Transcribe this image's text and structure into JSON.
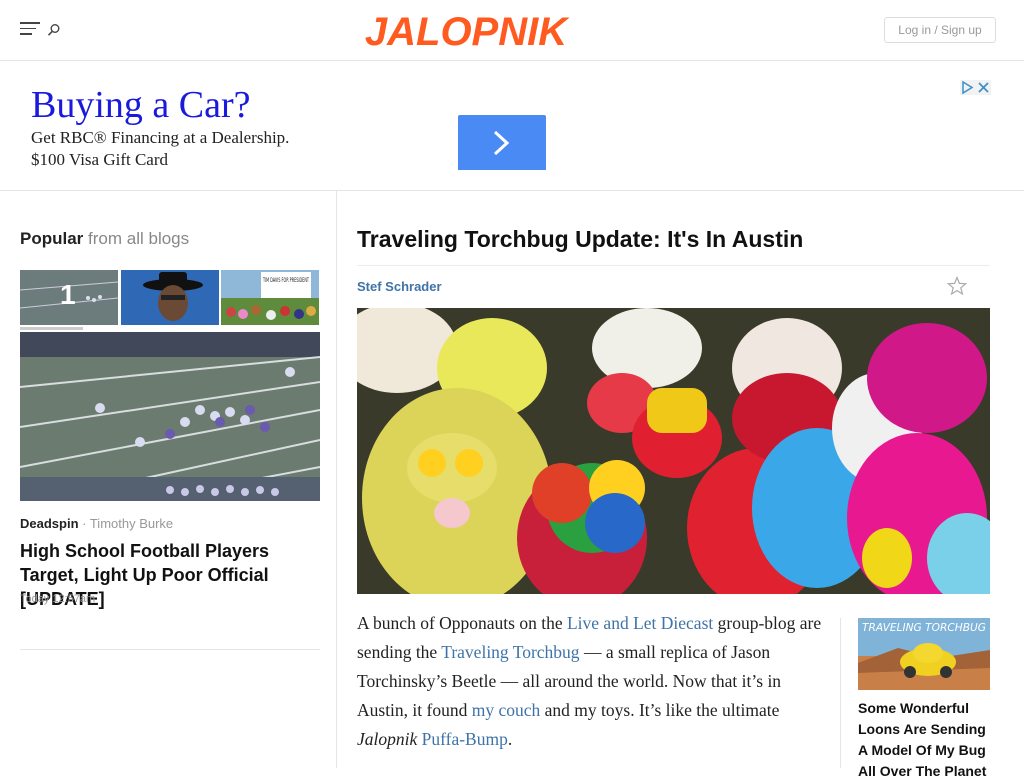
{
  "header": {
    "logo_text": "JALOPNIK",
    "login_label": "Log in / Sign up",
    "brand_color": "#ff5a1f"
  },
  "ad": {
    "headline": "Buying a Car?",
    "body": "Get RBC® Financing at a Dealership. $100 Visa Gift Card",
    "cta_color": "#4a8af4"
  },
  "sidebar": {
    "popular_label": "Popular",
    "popular_sub": "from all blogs",
    "thumbnails": [
      {
        "number": "1"
      },
      {
        "sign_text": "TIM DAVIS FOR PRESIDENT"
      }
    ],
    "featured": {
      "blog": "Deadspin",
      "separator": " · ",
      "author": "Timothy Burke",
      "headline": "High School Football Players Target, Light Up Poor Official [UPDATE]",
      "time": "Today 12:57am"
    }
  },
  "article": {
    "title": "Traveling Torchbug Update: It's In Austin",
    "author": "Stef Schrader",
    "body": {
      "t1": "A bunch of Opponauts on the ",
      "l1": "Live and Let Diecast",
      "t2": " group-blog are sending the ",
      "l2": "Traveling Torchbug",
      "t3": " — a small replica of Jason Torchinsky’s Beetle — all around the world. Now that it’s in Austin, it found ",
      "l3": "my couch",
      "t4": " and my toys. It’s like the ultimate ",
      "em1": "Jalopnik",
      "t5": " ",
      "l4": "Puffa-Bump",
      "t6": "."
    },
    "related": {
      "image_caption": "TRAVELING TORCHBUG",
      "title": "Some Wonderful Loons Are Sending A Model Of My Bug All Over The Planet"
    },
    "link_color": "#3f73a8"
  }
}
